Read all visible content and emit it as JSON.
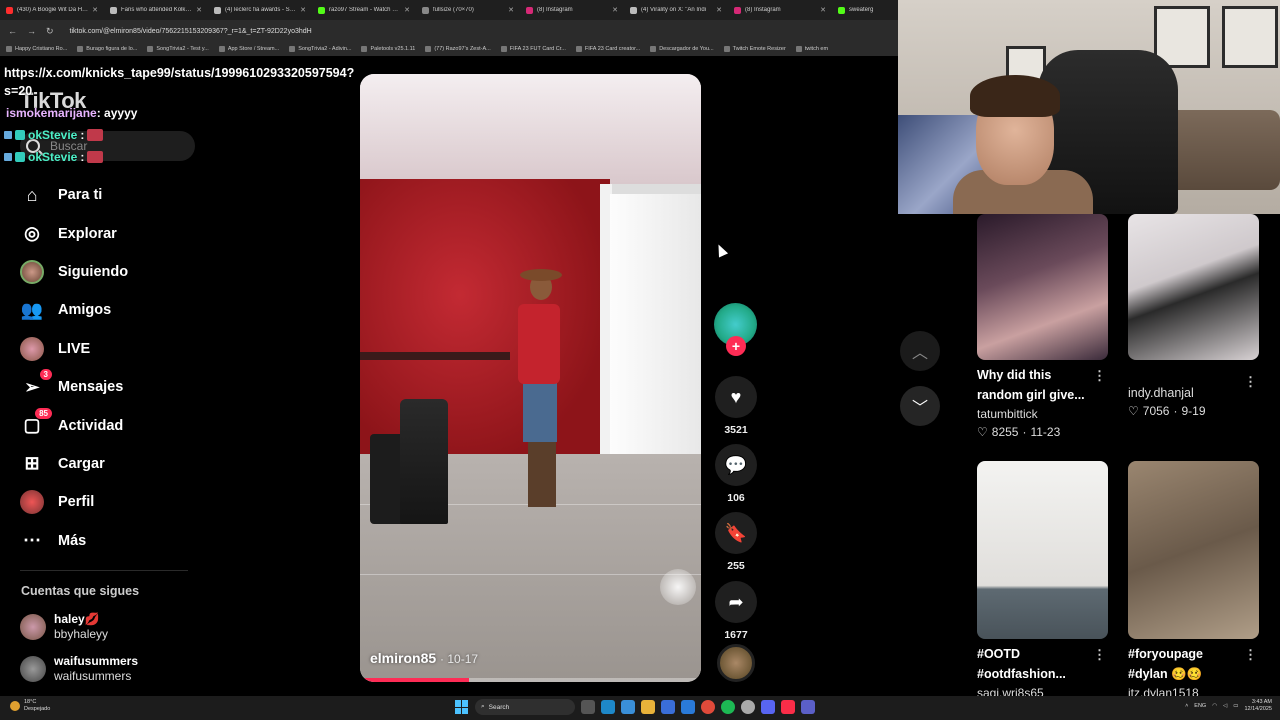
{
  "browser": {
    "tabs": [
      {
        "title": "(430) A Boogie Wit Da Hoodie",
        "color": "#ff2d2d"
      },
      {
        "title": "Fans who attended Kolkata",
        "color": "#bbbbbb"
      },
      {
        "title": "(4) leclerc fia awards - Search",
        "color": "#bbbbbb"
      },
      {
        "title": "razo97 Stream - Watch Live",
        "color": "#53fc18"
      },
      {
        "title": "fullsize (70×70)",
        "color": "#888888"
      },
      {
        "title": "(8) Instagram",
        "color": "#d62976"
      },
      {
        "title": "(4) Virality on X: \"An Indi",
        "color": "#bbbbbb"
      },
      {
        "title": "(8) Instagram",
        "color": "#d62976"
      },
      {
        "title": "sweaterg",
        "color": "#53fc18"
      }
    ],
    "url": "tiktok.com/@elmiron85/video/7562215153209367?_r=1&_t=ZT-92D22yo3hdH",
    "bookmarks": [
      "Happy Cristiano Ro...",
      "Burago figura de lo...",
      "SongTrivia2 - Test y...",
      "App Store / Stream...",
      "SongTrivia2 - Adivin...",
      "Paletools v25.1.11",
      "(77) Razo97's Zest-A...",
      "FIFA 23 FUT Card Cr...",
      "FIFA 23 Card creator...",
      "Descargador de You...",
      "Twitch Emote Resizer",
      "twitch em"
    ]
  },
  "overlay": {
    "link_text": "https://x.com/knicks_tape99/status/1999610293320597594?s=20",
    "logo_text": "TikTok",
    "chat_message": {
      "user": "ismokemarijane",
      "text": ": ayyyy"
    },
    "chat_rows": [
      {
        "user": "okStevie",
        "text": ":"
      },
      {
        "user": "okStevie",
        "text": ":"
      }
    ]
  },
  "search": {
    "placeholder": "Buscar"
  },
  "nav": {
    "items": [
      {
        "label": "Para ti",
        "icon": "home-icon"
      },
      {
        "label": "Explorar",
        "icon": "compass-icon"
      },
      {
        "label": "Siguiendo",
        "icon": "following-avatar-icon"
      },
      {
        "label": "Amigos",
        "icon": "friends-icon"
      },
      {
        "label": "LIVE",
        "icon": "live-avatar-icon"
      },
      {
        "label": "Mensajes",
        "icon": "messages-icon",
        "badge": "3"
      },
      {
        "label": "Actividad",
        "icon": "activity-icon",
        "badge": "85"
      },
      {
        "label": "Cargar",
        "icon": "upload-icon"
      },
      {
        "label": "Perfil",
        "icon": "profile-avatar-icon"
      },
      {
        "label": "Más",
        "icon": "more-icon"
      }
    ]
  },
  "following": {
    "title": "Cuentas que sigues",
    "accounts": [
      {
        "name": "haley💋",
        "handle": "bbyhaleyy"
      },
      {
        "name": "waifusummers",
        "handle": "waifusummers"
      }
    ]
  },
  "video": {
    "author": "elmiron85",
    "date": "· 10-17",
    "progress_fraction": 0.32,
    "likes": "3521",
    "comments": "106",
    "saves": "255",
    "shares": "1677"
  },
  "recommended": [
    {
      "title": "Why did this random girl give...",
      "user": "tatumbittick",
      "likes": "8255",
      "date": "11-23"
    },
    {
      "title": "",
      "user": "indy.dhanjal",
      "likes": "7056",
      "date": "9-19"
    },
    {
      "title": "#OOTD #ootdfashion...",
      "user": "sagi.wri8s65",
      "likes": "",
      "date": ""
    },
    {
      "title": "#foryoupage #dylan 🥴🥴",
      "user": "itz.dylan1518",
      "likes": "",
      "date": ""
    }
  ],
  "taskbar": {
    "weather_temp": "18°C",
    "weather_desc": "Despejado",
    "search_label": "Search",
    "lang": "ENG",
    "time": "3:43 AM",
    "date": "12/14/2025"
  },
  "colors": {
    "accent": "#fe2c55",
    "chat_user": "#4df0c8"
  }
}
